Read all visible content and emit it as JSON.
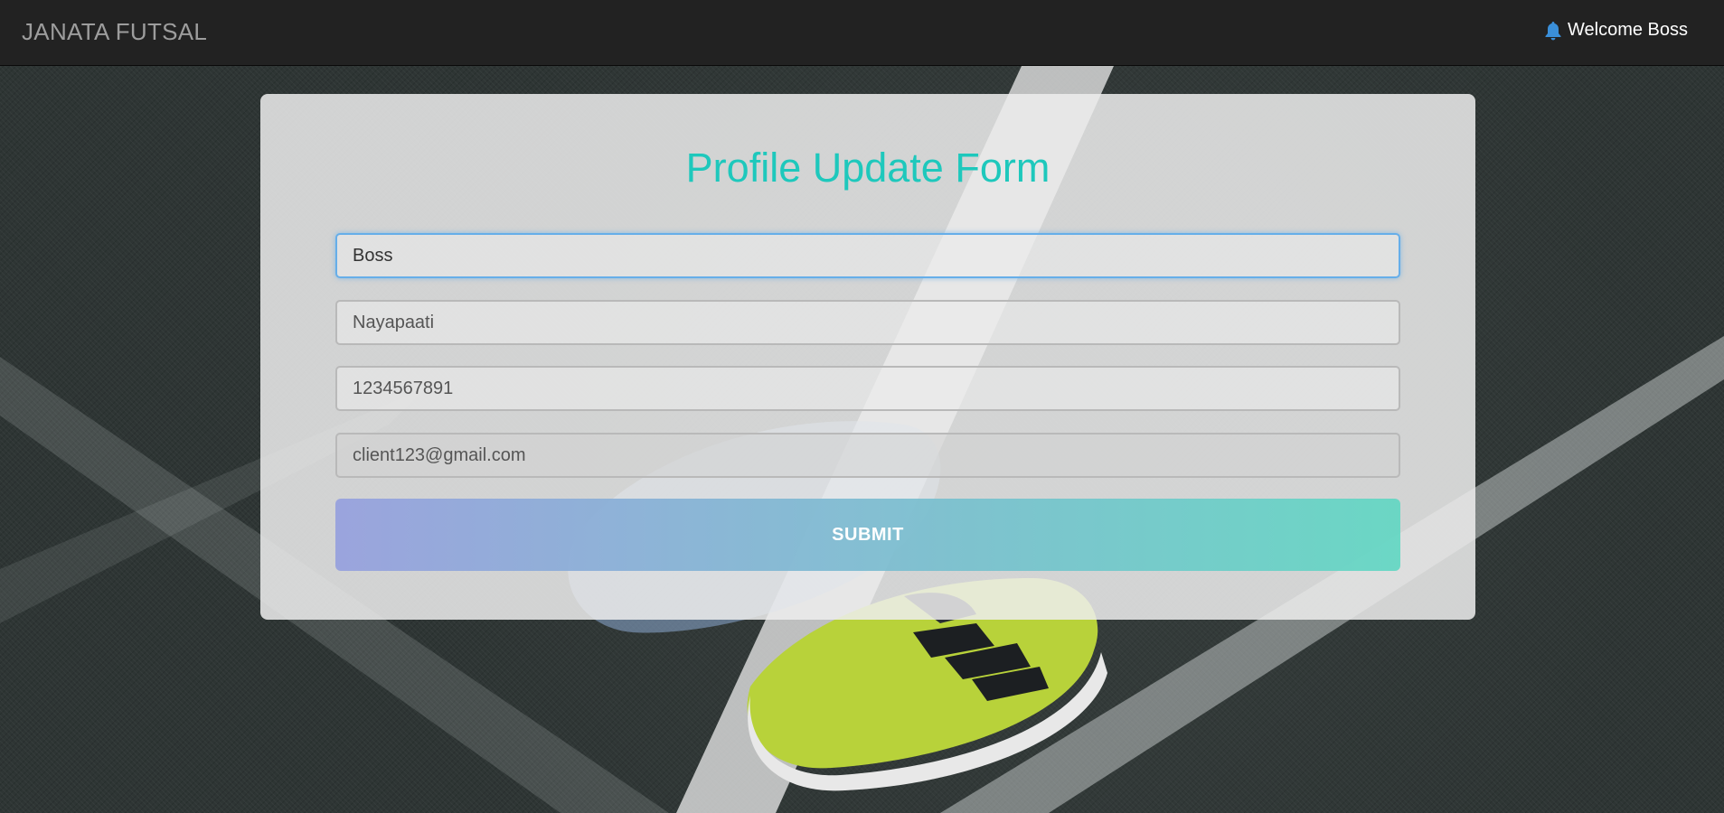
{
  "navbar": {
    "brand": "JANATA FUTSAL",
    "welcome_text": "Welcome Boss",
    "bell_icon": "bell-icon"
  },
  "form": {
    "title": "Profile Update Form",
    "fields": [
      {
        "name": "name",
        "value": "Boss",
        "focused": true
      },
      {
        "name": "address",
        "value": "Nayapaati"
      },
      {
        "name": "phone",
        "value": "1234567891"
      },
      {
        "name": "email",
        "value": "client123@gmail.com",
        "readonly": true
      }
    ],
    "submit_label": "SUBMIT"
  },
  "colors": {
    "navbar_bg": "#222222",
    "title": "#1ec8bc",
    "submit_gradient_start": "#96a0de",
    "submit_gradient_end": "#62d7c3",
    "focus_border": "#66aee9"
  }
}
